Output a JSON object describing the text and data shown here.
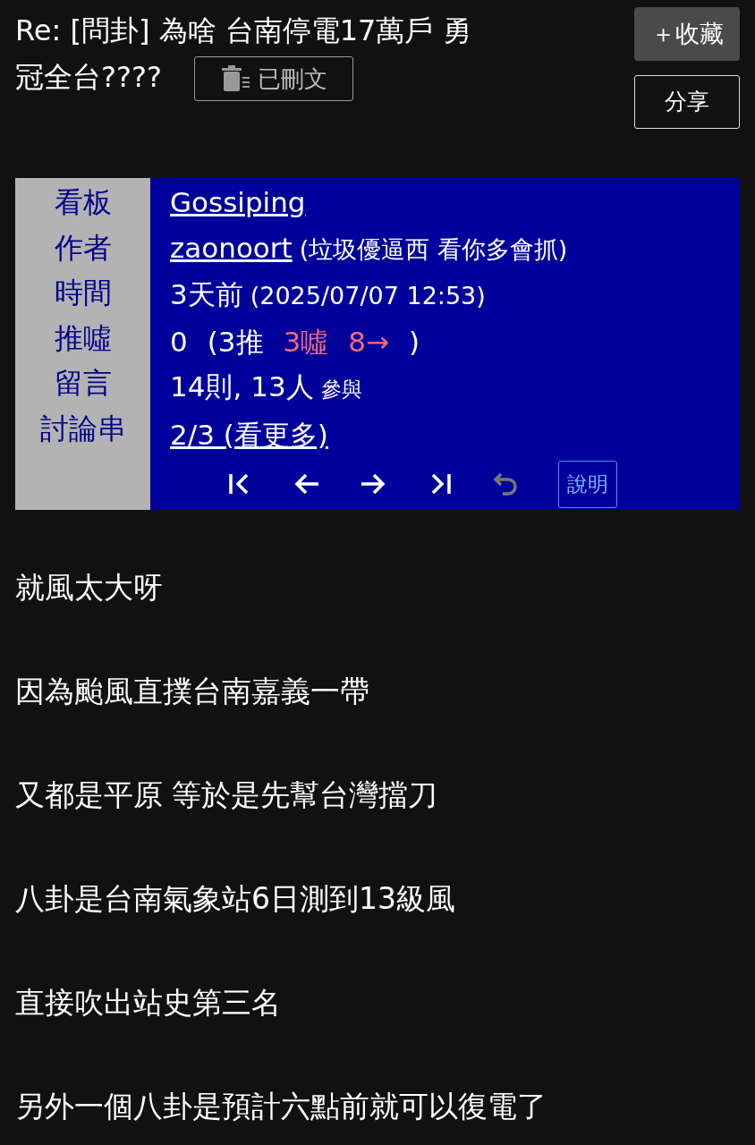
{
  "title_lines": [
    "Re: [問卦] 為啥 台南停電17萬戶 勇",
    "冠全台????"
  ],
  "deleted_badge": "已刪文",
  "buttons": [
    {
      "kind": "favorite",
      "label": "＋收藏"
    },
    {
      "kind": "share",
      "label": "分享"
    }
  ],
  "info_rows": [
    {
      "label": "看板",
      "parts": [
        {
          "kind": "link",
          "text": "Gossiping"
        }
      ]
    },
    {
      "label": "作者",
      "parts": [
        {
          "kind": "link",
          "text": "zaonoort"
        },
        {
          "kind": "note",
          "text": "(垃圾優逼西 看你多會抓)"
        }
      ]
    },
    {
      "label": "時間",
      "parts": [
        {
          "kind": "text",
          "text": "3天前"
        },
        {
          "kind": "note",
          "text": "(2025/07/07 12:53)"
        }
      ]
    },
    {
      "label": "推噓",
      "parts": [
        {
          "kind": "text",
          "text": "0",
          "color": "#ffffff"
        },
        {
          "kind": "text",
          "text": "(3推",
          "color": "#ffffff"
        },
        {
          "kind": "text",
          "text": "3噓",
          "color": "#f06a78"
        },
        {
          "kind": "text",
          "text": "8→",
          "color": "#f06a78"
        },
        {
          "kind": "text",
          "text": ")",
          "color": "#ffffff"
        }
      ]
    },
    {
      "label": "留言",
      "parts": [
        {
          "kind": "text",
          "text": "14則, 13人"
        },
        {
          "kind": "small",
          "text": "參與"
        }
      ]
    },
    {
      "label": "討論串",
      "parts": [
        {
          "kind": "link",
          "text": "2/3 (看更多)"
        }
      ]
    }
  ],
  "nav": [
    {
      "kind": "first",
      "disabled": false
    },
    {
      "kind": "prev",
      "disabled": false
    },
    {
      "kind": "next",
      "disabled": false
    },
    {
      "kind": "last",
      "disabled": false
    },
    {
      "kind": "undo",
      "disabled": true
    }
  ],
  "help_button": "說明",
  "paragraphs": [
    "就風太大呀",
    "因為颱風直撲台南嘉義一帶",
    "又都是平原 等於是先幫台灣擋刀",
    "八卦是台南氣象站6日測到13級風",
    "直接吹出站史第三名",
    "另外一個八卦是預計六點前就可以復電了"
  ]
}
